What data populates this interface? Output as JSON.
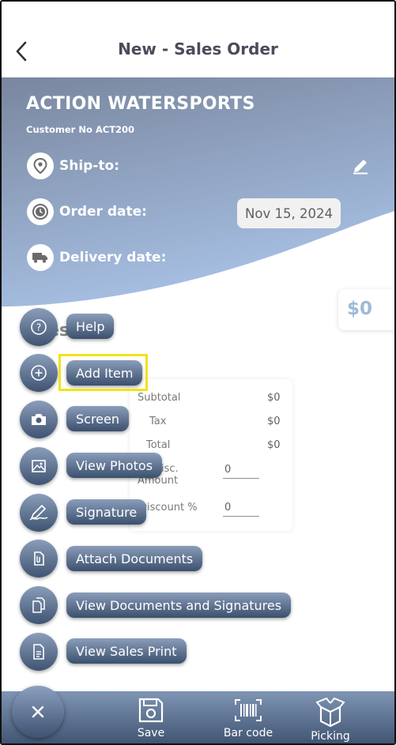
{
  "header": {
    "title": "New - Sales Order",
    "back_icon": "chevron-left-icon"
  },
  "customer": {
    "name": "ACTION WATERSPORTS",
    "number_text": "Customer No ACT200",
    "ship_to_label": "Ship-to:",
    "order_date_label": "Order date:",
    "order_date_value": "Nov 15, 2024",
    "delivery_date_label": "Delivery date:"
  },
  "total_badge": "$0",
  "lines_heading_fragment": "es",
  "summary": {
    "subtotal_label": "Subtotal",
    "subtotal_value": "$0",
    "tax_label": "Tax",
    "tax_value": "$0",
    "total_label": "Total",
    "total_value": "$0",
    "disc_amount_label_line1": "Disc.",
    "disc_amount_label_line2": "Amount",
    "disc_amount_value": "0",
    "discount_pct_label": "Discount %",
    "discount_pct_value": "0"
  },
  "fab_menu": [
    {
      "label": "Help",
      "icon": "help-icon"
    },
    {
      "label": "Add Item",
      "icon": "add-circle-icon"
    },
    {
      "label": "Screen",
      "icon": "camera-icon"
    },
    {
      "label": "View Photos",
      "icon": "image-icon"
    },
    {
      "label": "Signature",
      "icon": "signature-icon"
    },
    {
      "label": "Attach Documents",
      "icon": "attach-document-icon"
    },
    {
      "label": "View Documents and Signatures",
      "icon": "documents-icon"
    },
    {
      "label": "View Sales Print",
      "icon": "print-document-icon"
    }
  ],
  "bottom_bar": {
    "save_label": "Save",
    "barcode_label": "Bar code",
    "picking_label": "Picking"
  },
  "colors": {
    "header_gradient_top": "#4a5d7d",
    "header_gradient_bottom": "#7fa3d6",
    "fab_blue": "#4a6080",
    "highlight": "#f2e21a",
    "total_text": "#7a9fc9"
  }
}
